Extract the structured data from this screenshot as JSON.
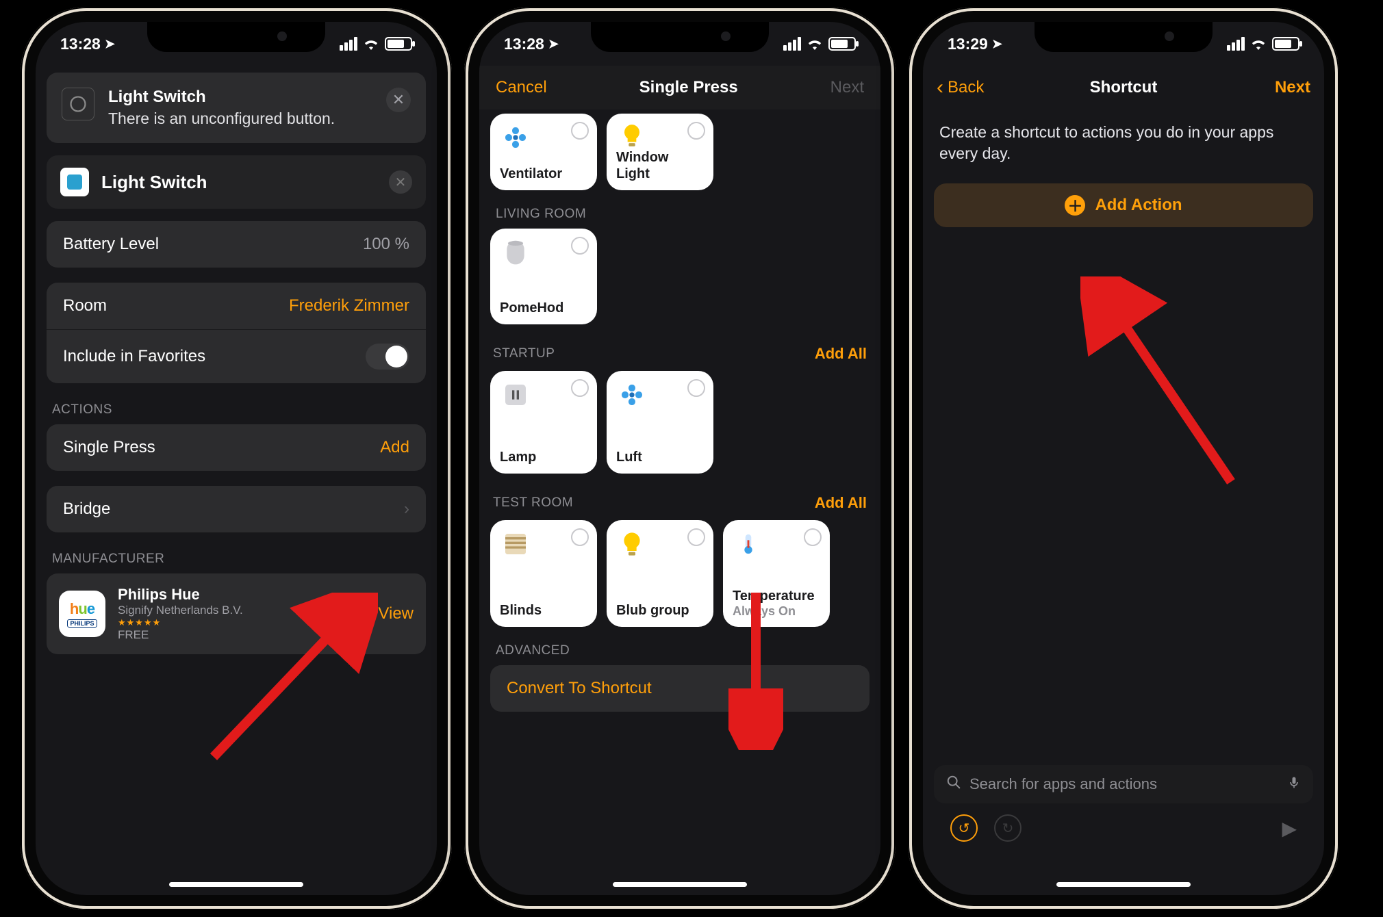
{
  "phone1": {
    "status_time": "13:28",
    "banner_title": "Light Switch",
    "banner_sub": "There is an unconfigured button.",
    "name_field": "Light Switch",
    "battery_level_label": "Battery Level",
    "battery_level_value": "100 %",
    "room_label": "Room",
    "room_value": "Frederik Zimmer",
    "favorites_label": "Include in Favorites",
    "section_actions": "ACTIONS",
    "single_press_label": "Single Press",
    "single_press_action": "Add",
    "bridge_label": "Bridge",
    "section_manufacturer": "MANUFACTURER",
    "mfr_name": "Philips Hue",
    "mfr_company": "Signify Netherlands B.V.",
    "mfr_price": "FREE",
    "view_button": "View"
  },
  "phone2": {
    "status_time": "13:28",
    "nav_cancel": "Cancel",
    "nav_title": "Single Press",
    "nav_next": "Next",
    "top_tiles": [
      {
        "label": "Ventilator",
        "icon": "fan"
      },
      {
        "label": "Window Light",
        "icon": "bulb"
      }
    ],
    "section_living": "LIVING ROOM",
    "living_tiles": [
      {
        "label": "PomeHod",
        "icon": "homepod"
      }
    ],
    "section_startup": "STARTUP",
    "add_all": "Add All",
    "startup_tiles": [
      {
        "label": "Lamp",
        "icon": "outlet"
      },
      {
        "label": "Luft",
        "icon": "fan"
      }
    ],
    "section_test": "TEST ROOM",
    "test_tiles": [
      {
        "label": "Blinds",
        "icon": "blinds",
        "sub": ""
      },
      {
        "label": "Blub group",
        "icon": "bulb",
        "sub": ""
      },
      {
        "label": "Temperature",
        "icon": "thermo",
        "sub": "Always On"
      }
    ],
    "section_advanced": "ADVANCED",
    "convert_label": "Convert To Shortcut"
  },
  "phone3": {
    "status_time": "13:29",
    "back_label": "Back",
    "nav_title": "Shortcut",
    "next_label": "Next",
    "desc": "Create a shortcut to actions you do in your apps every day.",
    "add_action_label": "Add Action",
    "search_placeholder": "Search for apps and actions"
  }
}
